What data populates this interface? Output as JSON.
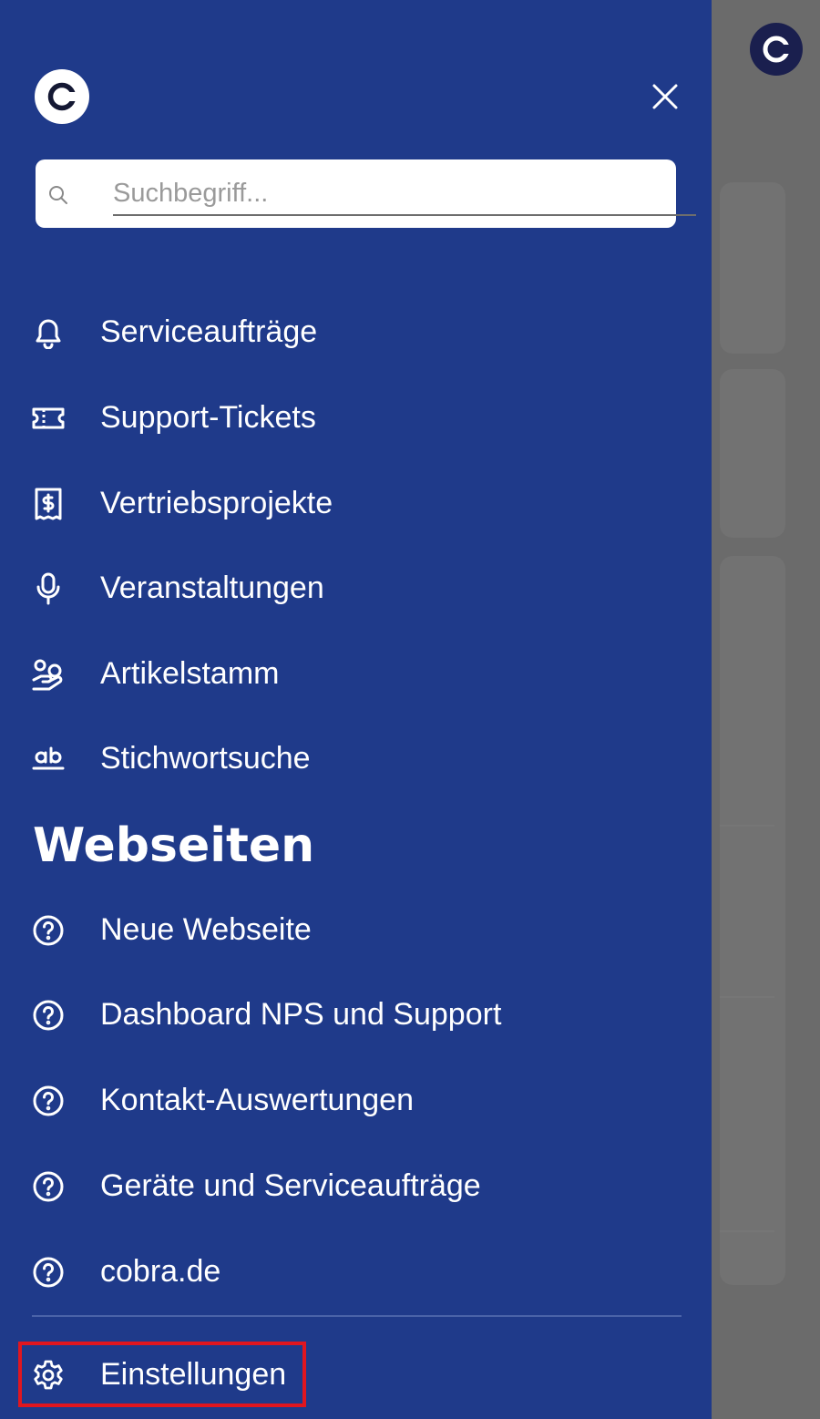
{
  "colors": {
    "drawer_bg": "#1f3a8a",
    "overlay_bg": "#6b6b6b",
    "highlight": "#e0161f",
    "text": "#ffffff"
  },
  "search": {
    "placeholder": "Suchbegriff..."
  },
  "nav": {
    "items": [
      {
        "label": "Serviceaufträge",
        "icon": "bell-icon"
      },
      {
        "label": "Support-Tickets",
        "icon": "ticket-icon"
      },
      {
        "label": "Vertriebsprojekte",
        "icon": "dollar-receipt-icon"
      },
      {
        "label": "Veranstaltungen",
        "icon": "microphone-icon"
      },
      {
        "label": "Artikelstamm",
        "icon": "hand-coins-icon"
      },
      {
        "label": "Stichwortsuche",
        "icon": "ab-text-icon"
      }
    ]
  },
  "websites": {
    "title": "Webseiten",
    "items": [
      {
        "label": "Neue Webseite",
        "icon": "help-circle-icon"
      },
      {
        "label": "Dashboard NPS und Support",
        "icon": "help-circle-icon"
      },
      {
        "label": "Kontakt-Auswertungen",
        "icon": "help-circle-icon"
      },
      {
        "label": "Geräte und Serviceaufträge",
        "icon": "help-circle-icon"
      },
      {
        "label": "cobra.de",
        "icon": "help-circle-icon"
      }
    ]
  },
  "settings": {
    "label": "Einstellungen",
    "icon": "gear-icon"
  }
}
